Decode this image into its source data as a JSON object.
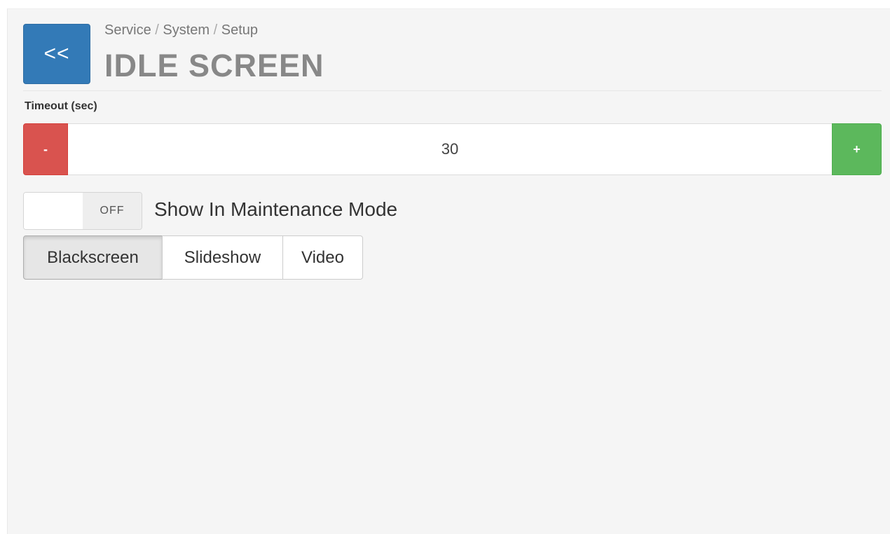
{
  "header": {
    "back_label": "<<",
    "breadcrumb": [
      "Service",
      "System",
      "Setup"
    ],
    "breadcrumb_separator": "/",
    "title": "IDLE SCREEN"
  },
  "timeout": {
    "label": "Timeout (sec)",
    "value": "30",
    "decrement_label": "-",
    "increment_label": "+"
  },
  "maintenance_toggle": {
    "state_label": "OFF",
    "label": "Show In Maintenance Mode"
  },
  "mode_selector": {
    "options": [
      "Blackscreen",
      "Slideshow",
      "Video"
    ],
    "selected": "Blackscreen"
  },
  "colors": {
    "back_button": "#337ab7",
    "decrement_button": "#d9534f",
    "increment_button": "#5cb85c"
  }
}
